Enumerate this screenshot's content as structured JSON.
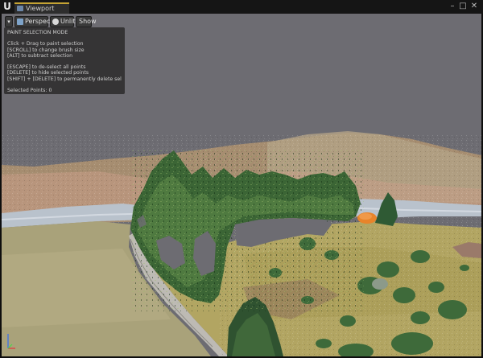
{
  "window": {
    "tab_label": "Viewport",
    "minimize_glyph": "–",
    "maximize_glyph": "□",
    "close_glyph": "✕",
    "logo_glyph": "U"
  },
  "toolbar": {
    "menu_glyph": "▾",
    "perspective_label": "Perspective",
    "lit_label": "Unlit",
    "show_label": "Show"
  },
  "paint_panel": {
    "title": "PAINT SELECTION MODE",
    "line1": "Click + Drag to paint selection",
    "line2": "[SCROLL] to change brush size",
    "line3": "[ALT] to subtract selection",
    "line4": "[ESCAPE] to de-select all points",
    "line5": "[DELETE] to hide selected points",
    "line6": "[SHIFT] + [DELETE] to permanently delete selected spoints",
    "selected_label": "Selected Points:",
    "selected_count": "0"
  },
  "icons": {
    "logo": "unreal-logo-icon",
    "viewport_tab": "viewport-icon",
    "perspective": "perspective-camera-icon",
    "lit": "lighting-sphere-icon",
    "axis": "axis-gizmo-icon"
  },
  "colors": {
    "accent_tab": "#c4a334",
    "sky": "#6d6c72",
    "selection_highlight": "#e8842a"
  }
}
